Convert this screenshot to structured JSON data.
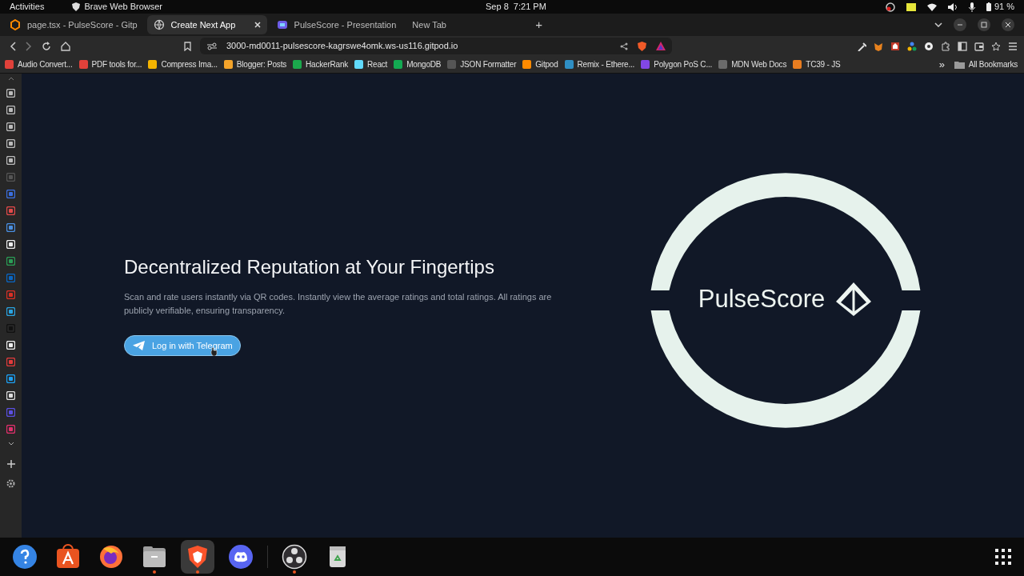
{
  "system_bar": {
    "activities": "Activities",
    "app_name": "Brave Web Browser",
    "datetime": "Sep 8  7:21 PM",
    "battery": "91 %"
  },
  "tabs": [
    {
      "title": "page.tsx - PulseScore - Gitp",
      "selected": false,
      "kind": "gitpod"
    },
    {
      "title": "Create Next App",
      "selected": true,
      "kind": "globe"
    },
    {
      "title": "PulseScore - Presentation",
      "selected": false,
      "kind": "slides"
    },
    {
      "title": "New Tab",
      "selected": false,
      "kind": "none"
    }
  ],
  "new_tab": "+",
  "address_bar": {
    "url": "3000-md0011-pulsescore-kagrswe4omk.ws-us116.gitpod.io"
  },
  "bookmarks": [
    {
      "label": "Audio Convert...",
      "color": "#e0413a"
    },
    {
      "label": "PDF tools for...",
      "color": "#e0413a"
    },
    {
      "label": "Compress Ima...",
      "color": "#f4b400"
    },
    {
      "label": "Blogger: Posts",
      "color": "#f4a42a"
    },
    {
      "label": "HackerRank",
      "color": "#1ba94c"
    },
    {
      "label": "React",
      "color": "#61dafb"
    },
    {
      "label": "MongoDB",
      "color": "#13aa52"
    },
    {
      "label": "JSON Formatter",
      "color": "#555555"
    },
    {
      "label": "Gitpod",
      "color": "#ff8a00"
    },
    {
      "label": "Remix - Ethere...",
      "color": "#2f8fc4"
    },
    {
      "label": "Polygon PoS C...",
      "color": "#8247e5"
    },
    {
      "label": "MDN Web Docs",
      "color": "#6b6b6b"
    },
    {
      "label": "TC39 - JS",
      "color": "#e87d20"
    }
  ],
  "bookmarks_more": "»",
  "all_bookmarks": "All Bookmarks",
  "hero": {
    "heading": "Decentralized Reputation at Your Fingertips",
    "description": "Scan and rate users instantly via QR codes. Instantly view the average ratings and total ratings. All ratings are publicly verifiable, ensuring transparency.",
    "button": "Log in with Telegram"
  },
  "logo": {
    "wordmark": "PulseScore"
  },
  "dock": [
    {
      "kind": "help",
      "running": false,
      "selected": false
    },
    {
      "kind": "store",
      "running": false,
      "selected": false
    },
    {
      "kind": "firefox",
      "running": false,
      "selected": false
    },
    {
      "kind": "files",
      "running": true,
      "selected": false
    },
    {
      "kind": "brave",
      "running": true,
      "selected": true
    },
    {
      "kind": "discord",
      "running": false,
      "selected": false
    },
    {
      "kind": "obs",
      "running": true,
      "selected": false
    },
    {
      "kind": "trash",
      "running": false,
      "selected": false
    }
  ]
}
